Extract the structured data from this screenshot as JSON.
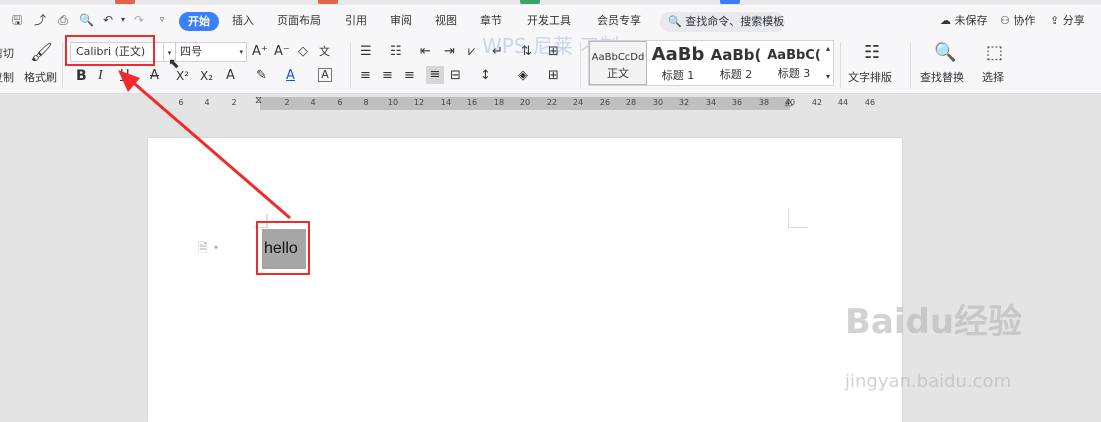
{
  "menubar": {
    "start_tab": "开始",
    "tabs": [
      "插入",
      "页面布局",
      "引用",
      "审阅",
      "视图",
      "章节",
      "开发工具",
      "会员专享"
    ],
    "search_placeholder": "查找命令、搜索模板",
    "unsaved": "未保存",
    "collaborate": "协作",
    "share": "分享"
  },
  "ribbon": {
    "cut_label": "剪切",
    "copy_label": "复制",
    "format_painter_label": "格式刷",
    "font_name": "Calibri (正文)",
    "font_size": "四号",
    "grow_font": "A⁺",
    "shrink_font": "A⁻",
    "bold": "B",
    "italic": "I",
    "underline": "U",
    "superscript": "X²",
    "subscript": "X₂",
    "styles": [
      {
        "preview": "AaBbCcDd",
        "label": "正文"
      },
      {
        "preview": "AaBb",
        "label": "标题 1"
      },
      {
        "preview": "AaBb(",
        "label": "标题 2"
      },
      {
        "preview": "AaBbC(",
        "label": "标题 3"
      }
    ],
    "text_layout_label": "文字排版",
    "find_replace_label": "查找替换",
    "select_label": "选择"
  },
  "ruler": {
    "ticks": [
      "6",
      "4",
      "2",
      "2",
      "4",
      "6",
      "8",
      "10",
      "12",
      "14",
      "16",
      "18",
      "20",
      "22",
      "24",
      "26",
      "28",
      "30",
      "32",
      "34",
      "36",
      "38",
      "40",
      "42",
      "44",
      "46"
    ]
  },
  "document": {
    "text": "hello"
  },
  "watermark": {
    "brand": "Baidu经验",
    "url": "jingyan.baidu.com",
    "overlay": "WPS 尼莱 刁制"
  },
  "colors": {
    "accent": "#3d7eff",
    "annotation": "#ef2b2b",
    "selection": "#a6a6a6"
  }
}
